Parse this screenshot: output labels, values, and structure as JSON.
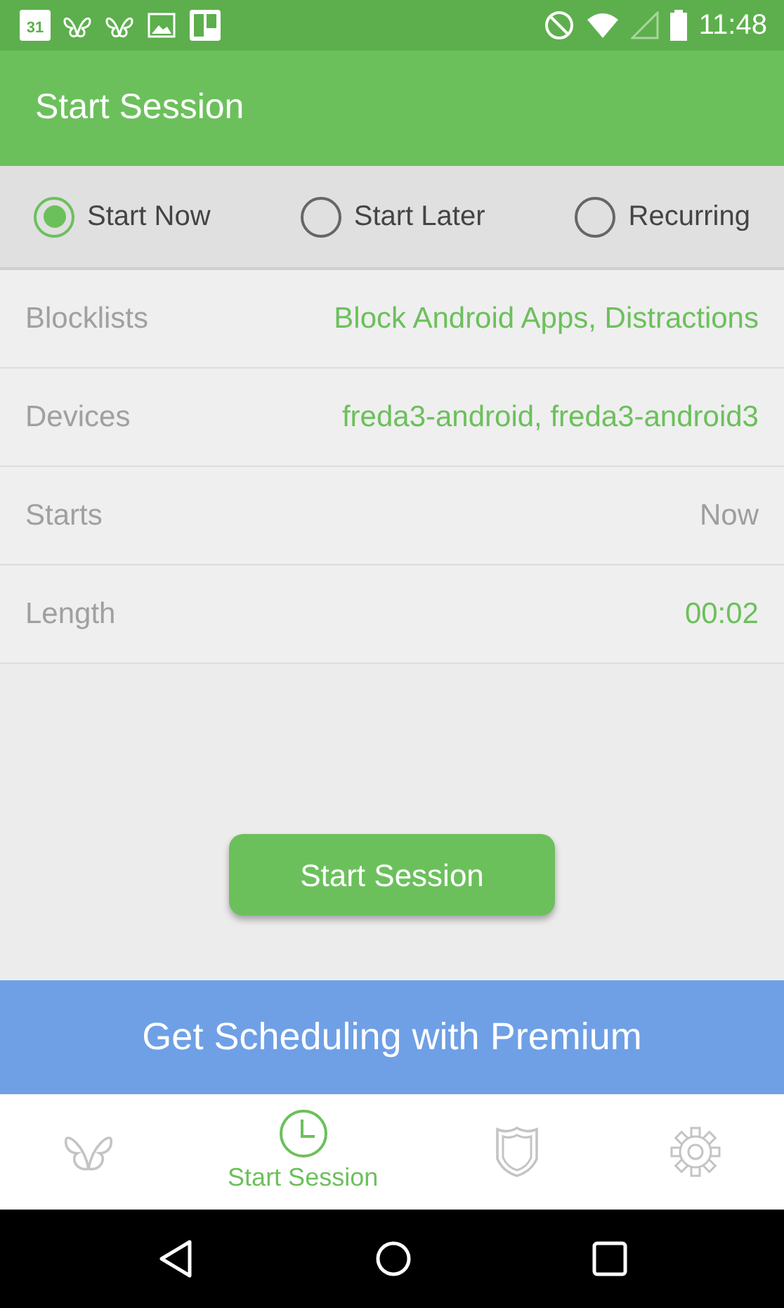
{
  "status_bar": {
    "calendar_day": "31",
    "time": "11:48"
  },
  "app_bar": {
    "title": "Start Session"
  },
  "start_options": [
    {
      "label": "Start Now",
      "selected": true
    },
    {
      "label": "Start Later",
      "selected": false
    },
    {
      "label": "Recurring",
      "selected": false
    }
  ],
  "settings": [
    {
      "label": "Blocklists",
      "value": "Block Android Apps, Distractions",
      "color": "#6cc05c"
    },
    {
      "label": "Devices",
      "value": "freda3-android, freda3-android3",
      "color": "#6cc05c"
    },
    {
      "label": "Starts",
      "value": "Now",
      "color": "#9e9e9e"
    },
    {
      "label": "Length",
      "value": "00:02",
      "color": "#6cc05c"
    }
  ],
  "start_button": "Start Session",
  "premium_banner": "Get Scheduling with Premium",
  "bottom_nav": [
    {
      "kind": "butterfly",
      "selected": false
    },
    {
      "kind": "clock",
      "label": "Start Session",
      "selected": true
    },
    {
      "kind": "shield",
      "selected": false
    },
    {
      "kind": "gear",
      "selected": false
    }
  ]
}
